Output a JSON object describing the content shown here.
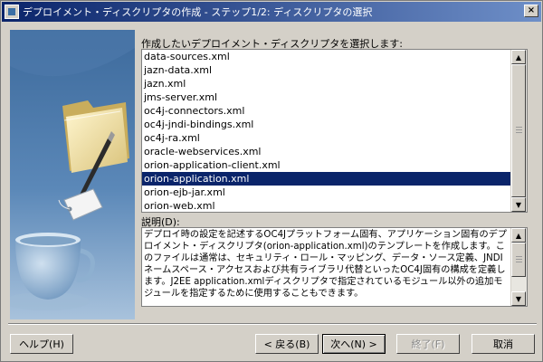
{
  "window": {
    "title": "デプロイメント・ディスクリプタの作成 - ステップ1/2: ディスクリプタの選択",
    "close_glyph": "×"
  },
  "list": {
    "label": "作成したいデプロイメント・ディスクリプタを選択します:",
    "items": [
      "data-sources.xml",
      "jazn-data.xml",
      "jazn.xml",
      "jms-server.xml",
      "oc4j-connectors.xml",
      "oc4j-jndi-bindings.xml",
      "oc4j-ra.xml",
      "oracle-webservices.xml",
      "orion-application-client.xml",
      "orion-application.xml",
      "orion-ejb-jar.xml",
      "orion-web.xml"
    ],
    "selected": "orion-application.xml"
  },
  "description": {
    "label": "説明(D):",
    "text": "デプロイ時の設定を記述するOC4Jプラットフォーム固有、アプリケーション固有のデプロイメント・ディスクリプタ(orion-application.xml)のテンプレートを作成します。このファイルは通常は、セキュリティ・ロール・マッピング、データ・ソース定義、JNDIネームスペース・アクセスおよび共有ライブラリ代替といったOC4J固有の構成を定義します。J2EE application.xmlディスクリプタで指定されているモジュール以外の追加モジュールを指定するために使用することもできます。"
  },
  "buttons": {
    "help": "ヘルプ(H)",
    "back": "< 戻る(B)",
    "next": "次へ(N) >",
    "finish": "終了(F)",
    "cancel": "取消"
  },
  "colors": {
    "titlebar_start": "#0a246a",
    "titlebar_end": "#6e8fc8",
    "selection": "#0a246a",
    "dialog_bg": "#d4d0c8"
  }
}
